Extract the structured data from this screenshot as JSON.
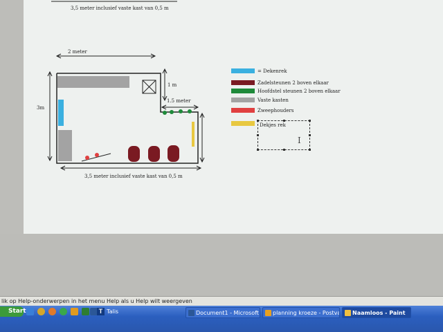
{
  "drawing": {
    "top_dim_label": "3,5 meter inclusief vaste kast van 0,5 m",
    "width_label": "2 meter",
    "height_label": "3m",
    "right_dim_label": "1 m",
    "step_dim_label": "1.5 meter",
    "bottom_dim_label": "3,5 meter inclusief vaste kast van 0,5 m"
  },
  "legend": [
    {
      "label": "= Dekenrek",
      "color": "#3ab0e0"
    },
    {
      "label": "Zadelsteunen 2 boven elkaar",
      "color": "#7a1a22"
    },
    {
      "label": "Hoofdstel steunen 2 boven elkaar",
      "color": "#1e8a3a"
    },
    {
      "label": "Vaste kasten",
      "color": "#a3a3a3"
    },
    {
      "label": "Zweephouders",
      "color": "#e04040"
    },
    {
      "label": "",
      "color": "#e8c840"
    }
  ],
  "textbox": {
    "text": "Dekjes rek"
  },
  "status_bar": {
    "text": "lik op Help-onderwerpen in het menu Help als u Help wilt weergeven"
  },
  "taskbar": {
    "start": "Start",
    "talis": "Talis",
    "tasks": [
      {
        "label": "Document1 - Microsoft ...",
        "icon_color": "#2b5797"
      },
      {
        "label": "planning kroeze - Postva...",
        "icon_color": "#e8a020"
      },
      {
        "label": "Naamloos - Paint",
        "icon_color": "#f0c040"
      }
    ]
  }
}
